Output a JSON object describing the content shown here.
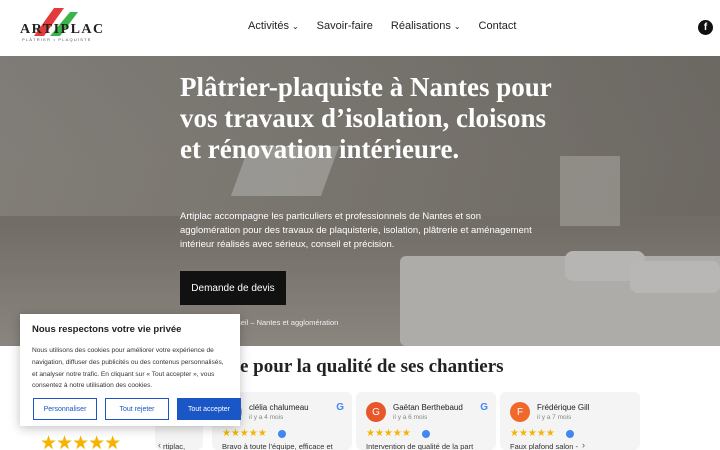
{
  "brand": {
    "name": "ARTIPLAC",
    "tagline": "PLÂTRIER • PLAQUISTE",
    "colors": {
      "red": "#e23b3b",
      "green": "#3bb54a"
    }
  },
  "nav": {
    "items": [
      {
        "label": "Activités",
        "has_dropdown": true
      },
      {
        "label": "Savoir-faire",
        "has_dropdown": false
      },
      {
        "label": "Réalisations",
        "has_dropdown": true
      },
      {
        "label": "Contact",
        "has_dropdown": false
      }
    ],
    "caret": "⌄",
    "social_icon": "facebook-icon",
    "social_glyph": "f"
  },
  "hero": {
    "title": "Plâtrier-plaquiste à Nantes pour vos travaux d’isolation, cloisons et rénovation intérieure.",
    "text": "Artiplac accompagne les particuliers et professionnels de Nantes et son agglomération pour des travaux de plaquisterie, isolation, plâtrerie et aménagement intérieur réalisés avec sérieux, conseil et précision.",
    "cta_label": "Demande de devis",
    "breadcrumb": "seil – Nantes et agglomération"
  },
  "reviews": {
    "section_title": "e pour la qualité de ses chantiers",
    "big_stars": "★★★★★",
    "left_partial_text": "rtiplac,",
    "items": [
      {
        "initial": "",
        "name": "clélia chalumeau",
        "date": "il y a 4 mois",
        "stars": "★★★★★",
        "text": "Bravo à toute l’équipe, efficace et",
        "avatar_color": "#9e9e9e"
      },
      {
        "initial": "G",
        "name": "Gaëtan Berthebaud",
        "date": "il y a 6 mois",
        "stars": "★★★★★",
        "text": "Intervention de qualité de la part",
        "avatar_color": "#e8562a"
      },
      {
        "initial": "F",
        "name": "Frédérique Gill",
        "date": "il y a 7 mois",
        "stars": "★★★★★",
        "text": "Faux plafond salon -",
        "avatar_color": "#f0682a"
      }
    ],
    "google_glyph": "G",
    "arrow_left": "‹",
    "arrow_right": "›"
  },
  "cookie": {
    "title": "Nous respectons votre vie privée",
    "text": "Nous utilisons des cookies pour améliorer votre expérience de navigation, diffuser des publicités ou des contenus personnalisés, et analyser notre trafic. En cliquant sur « Tout accepter », vous consentez à notre utilisation des cookies.",
    "customize_label": "Personnaliser",
    "reject_label": "Tout rejeter",
    "accept_label": "Tout accepter"
  }
}
